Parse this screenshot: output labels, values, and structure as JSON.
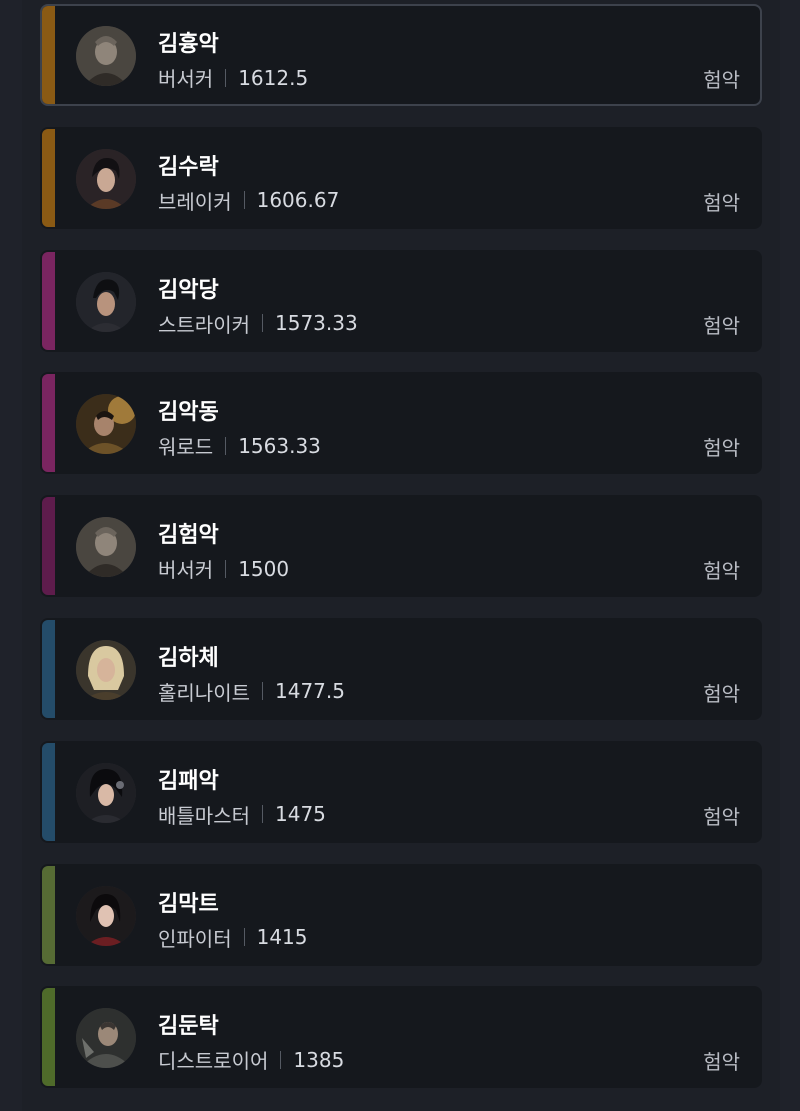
{
  "characters": [
    {
      "name": "김흉악",
      "class": "버서커",
      "score": "1612.5",
      "tag": "험악",
      "stripe_color": "#8a5a14",
      "avatar_icon": "berserker-portrait-icon",
      "selected": true
    },
    {
      "name": "김수락",
      "class": "브레이커",
      "score": "1606.67",
      "tag": "험악",
      "stripe_color": "#8a5a14",
      "avatar_icon": "breaker-portrait-icon",
      "selected": false
    },
    {
      "name": "김악당",
      "class": "스트라이커",
      "score": "1573.33",
      "tag": "험악",
      "stripe_color": "#7a2560",
      "avatar_icon": "striker-portrait-icon",
      "selected": false
    },
    {
      "name": "김악동",
      "class": "워로드",
      "score": "1563.33",
      "tag": "험악",
      "stripe_color": "#7a2560",
      "avatar_icon": "warlord-portrait-icon",
      "selected": false
    },
    {
      "name": "김험악",
      "class": "버서커",
      "score": "1500",
      "tag": "험악",
      "stripe_color": "#5e1c4c",
      "avatar_icon": "berserker-portrait-icon",
      "selected": false
    },
    {
      "name": "김하체",
      "class": "홀리나이트",
      "score": "1477.5",
      "tag": "험악",
      "stripe_color": "#244c69",
      "avatar_icon": "holyknight-portrait-icon",
      "selected": false
    },
    {
      "name": "김패악",
      "class": "배틀마스터",
      "score": "1475",
      "tag": "험악",
      "stripe_color": "#244c69",
      "avatar_icon": "battlemaster-portrait-icon",
      "selected": false
    },
    {
      "name": "김막트",
      "class": "인파이터",
      "score": "1415",
      "tag": "",
      "stripe_color": "#566b34",
      "avatar_icon": "infighter-portrait-icon",
      "selected": false
    },
    {
      "name": "김둔탁",
      "class": "디스트로이어",
      "score": "1385",
      "tag": "험악",
      "stripe_color": "#4f6b2a",
      "avatar_icon": "destroyer-portrait-icon",
      "selected": false
    }
  ]
}
